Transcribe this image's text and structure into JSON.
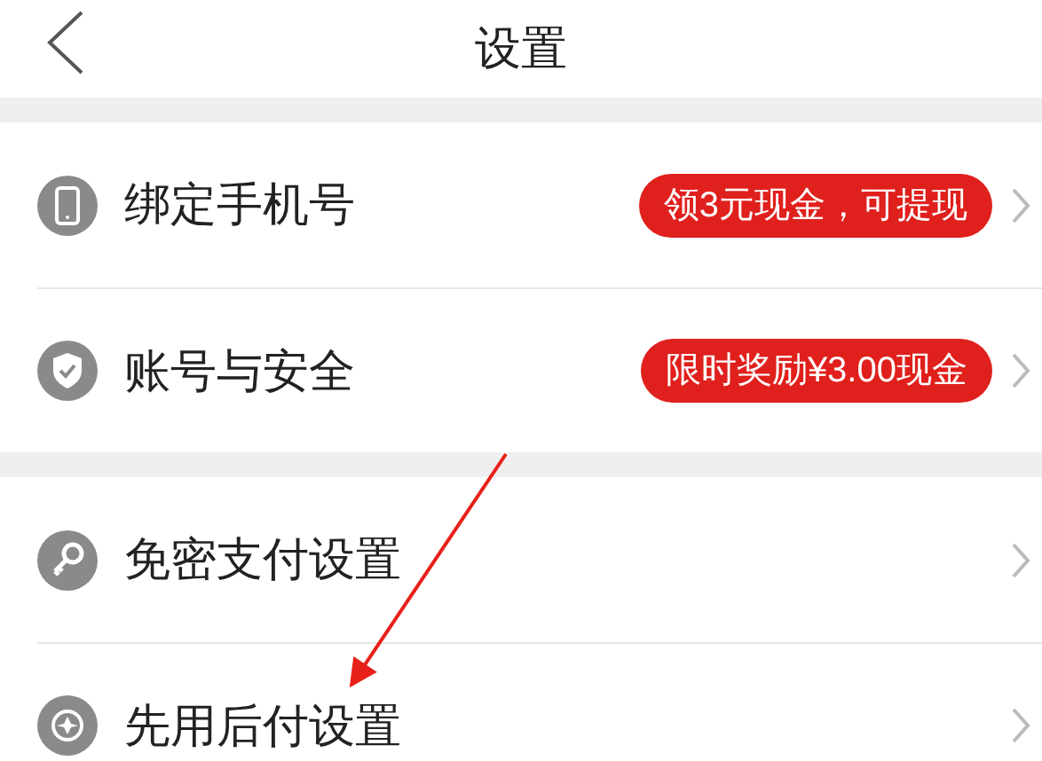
{
  "header": {
    "title": "设置"
  },
  "sections": [
    {
      "items": [
        {
          "label": "绑定手机号",
          "badge": "领3元现金，可提现"
        },
        {
          "label": "账号与安全",
          "badge": "限时奖励¥3.00现金"
        }
      ]
    },
    {
      "items": [
        {
          "label": "免密支付设置"
        },
        {
          "label": "先用后付设置"
        }
      ]
    }
  ]
}
